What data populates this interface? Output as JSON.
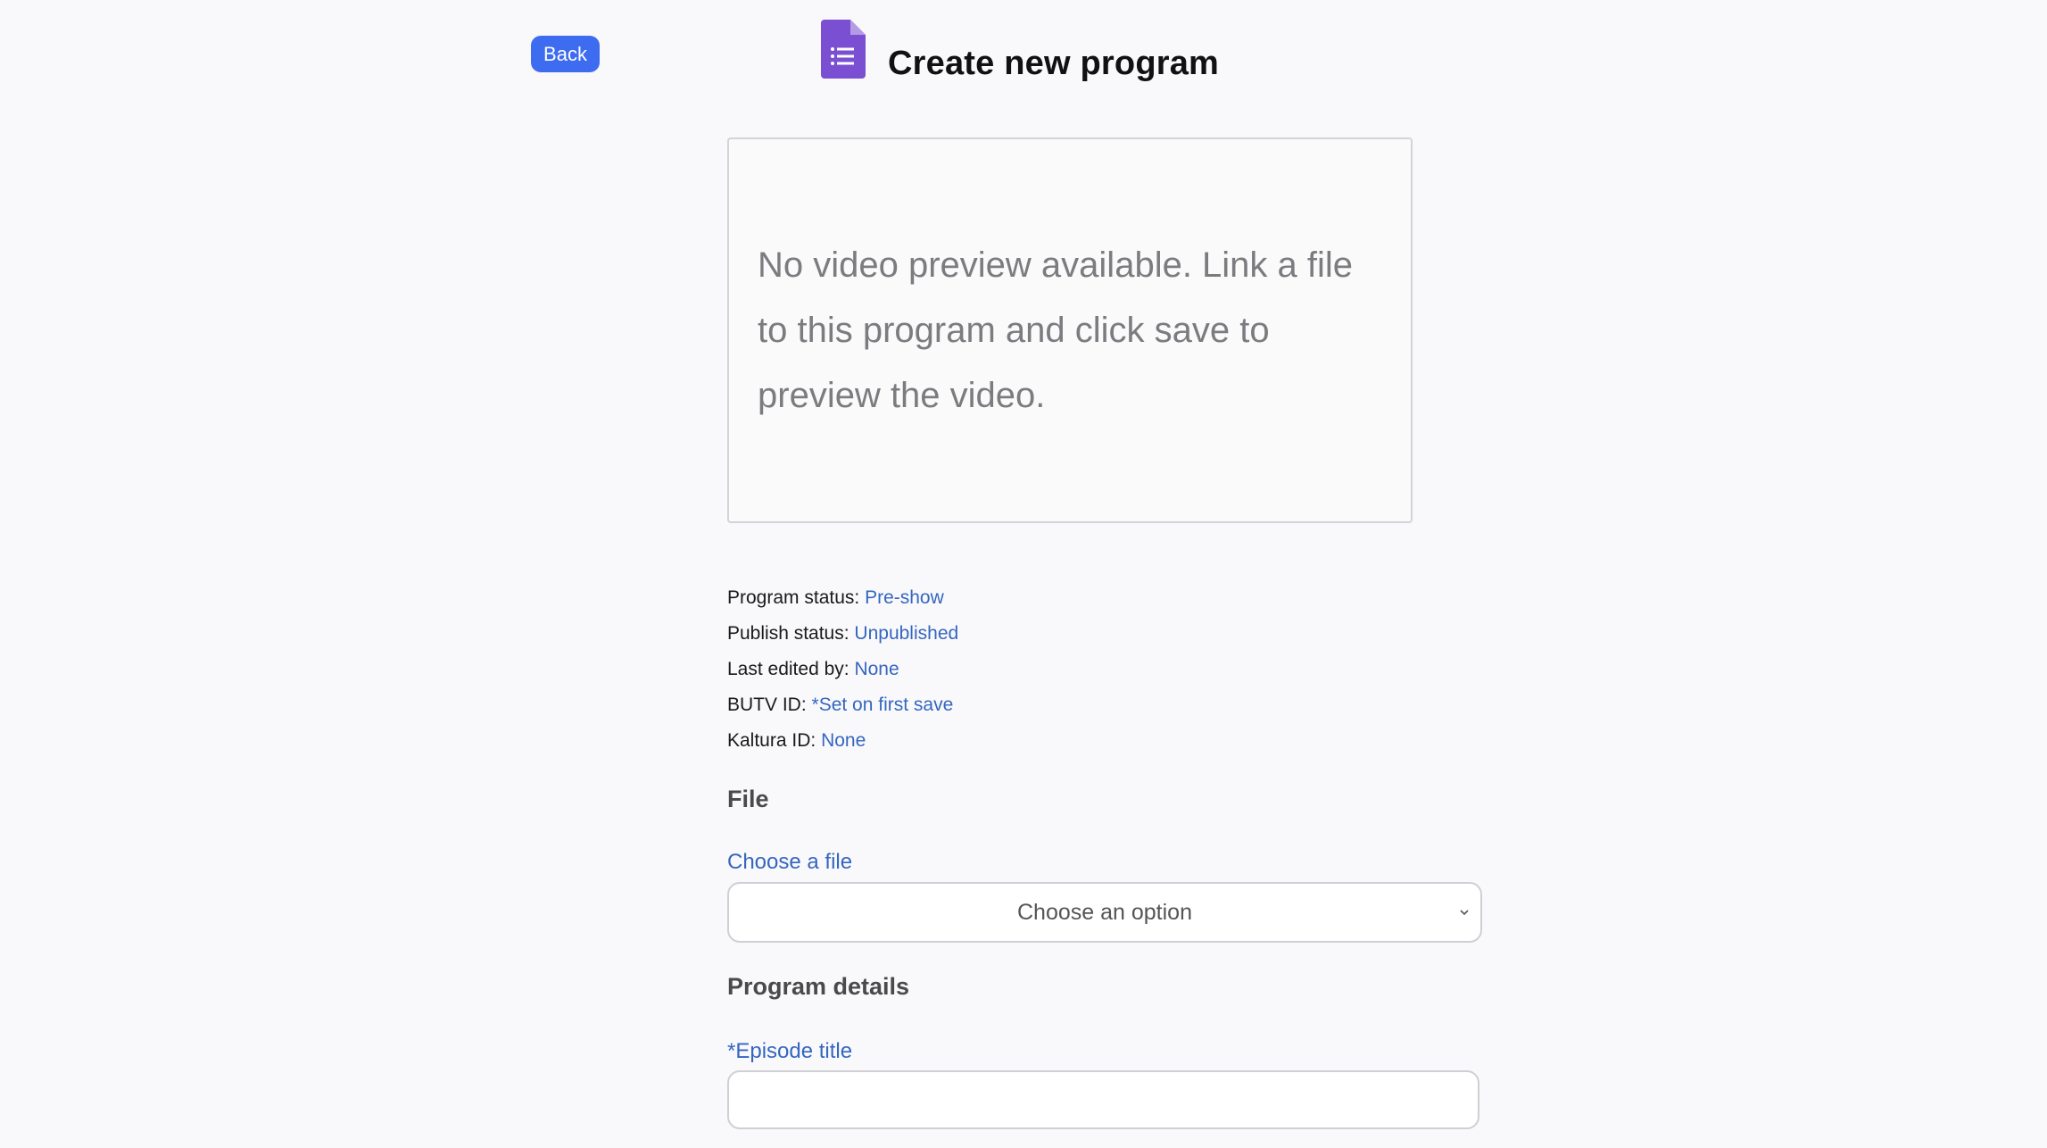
{
  "header": {
    "back_label": "Back",
    "title": "Create new program",
    "icon": "form-document-icon",
    "icon_color": "#7a4fd1"
  },
  "preview": {
    "lines": [
      "No video preview available. Link a file",
      "to this program and click save to",
      "preview the video."
    ]
  },
  "meta": {
    "program_status": {
      "label": "Program status:",
      "value": "Pre-show"
    },
    "publish_status": {
      "label": "Publish status:",
      "value": "Unpublished"
    },
    "last_edited_by": {
      "label": "Last edited by:",
      "value": "None"
    },
    "butv_id": {
      "label": "BUTV ID:",
      "value": "*Set on first save"
    },
    "kaltura_id": {
      "label": "Kaltura ID:",
      "value": "None"
    }
  },
  "file_section": {
    "heading": "File",
    "choose_label": "Choose a file",
    "select_value": "Choose an option"
  },
  "details_section": {
    "heading": "Program details",
    "episode_title_label": "*Episode title",
    "episode_title_value": ""
  },
  "colors": {
    "accent": "#3d6cf0",
    "link": "#3566c0",
    "background": "#f9f9fc"
  }
}
